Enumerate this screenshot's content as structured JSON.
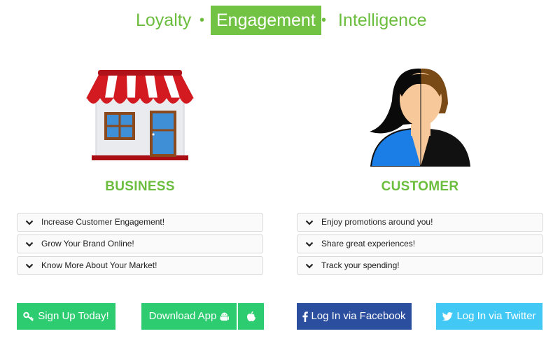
{
  "tabs": [
    {
      "label": "Loyalty"
    },
    {
      "label": "Engagement"
    },
    {
      "label": "Intelligence"
    }
  ],
  "separator": "•",
  "business": {
    "title": "BUSINESS",
    "items": [
      {
        "label": "Increase Customer Engagement!"
      },
      {
        "label": "Grow Your Brand Online!"
      },
      {
        "label": "Know More About Your Market!"
      }
    ]
  },
  "customer": {
    "title": "CUSTOMER",
    "items": [
      {
        "label": "Enjoy promotions around you!"
      },
      {
        "label": "Share great experiences!"
      },
      {
        "label": "Track your spending!"
      }
    ]
  },
  "buttons": {
    "signup": "Sign Up Today!",
    "download": "Download App",
    "facebook": "Log In via Facebook",
    "twitter": "Log In via Twitter"
  },
  "colors": {
    "accent_green": "#72c243",
    "button_green": "#2ecc71",
    "facebook_blue": "#2b4f9e",
    "twitter_blue": "#42c8f4"
  },
  "icons": {
    "business": "store-icon",
    "customer": "person-icon",
    "signup": "key-icon",
    "download": "android-icon",
    "ios": "apple-icon",
    "facebook": "facebook-icon",
    "twitter": "twitter-icon",
    "accordion": "chevron-down-icon"
  }
}
